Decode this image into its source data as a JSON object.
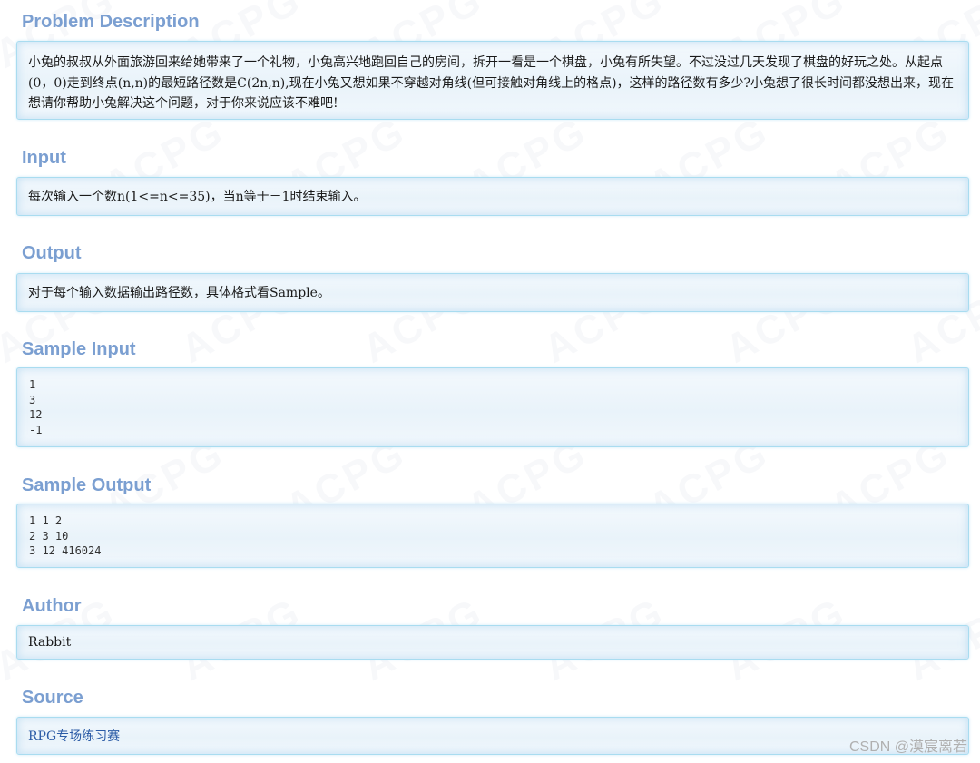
{
  "watermark": "ACPG",
  "sections": {
    "problem": {
      "title": "Problem Description",
      "text": "小兔的叔叔从外面旅游回来给她带来了一个礼物，小兔高兴地跑回自己的房间，拆开一看是一个棋盘，小兔有所失望。不过没过几天发现了棋盘的好玩之处。从起点(0，0)走到终点(n,n)的最短路径数是C(2n,n),现在小兔又想如果不穿越对角线(但可接触对角线上的格点)，这样的路径数有多少?小兔想了很长时间都没想出来，现在想请你帮助小兔解决这个问题，对于你来说应该不难吧!"
    },
    "input": {
      "title": "Input",
      "text": "每次输入一个数n(1<=n<=35)，当n等于－1时结束输入。"
    },
    "output": {
      "title": "Output",
      "text": "对于每个输入数据输出路径数，具体格式看Sample。"
    },
    "sample_input": {
      "title": "Sample Input",
      "lines": [
        "1",
        "3",
        "12",
        "-1"
      ]
    },
    "sample_output": {
      "title": "Sample Output",
      "lines": [
        "1 1 2",
        "2 3 10",
        "3 12 416024"
      ]
    },
    "author": {
      "title": "Author",
      "text": "Rabbit"
    },
    "source": {
      "title": "Source",
      "text": "RPG专场练习赛"
    }
  },
  "footer": {
    "csdn_credit": "CSDN @漠宸离若"
  },
  "colors": {
    "section_title": "#7b9fd1",
    "panel_border": "#a9dcf0",
    "link": "#2b5ba6"
  }
}
